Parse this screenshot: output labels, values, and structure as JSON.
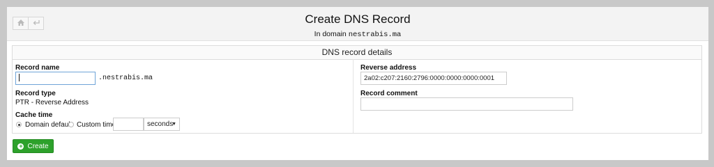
{
  "header": {
    "title": "Create DNS Record",
    "subtitle_prefix": "In domain",
    "domain": "nestrabis.ma",
    "nav": [
      {
        "icon": "home-icon"
      },
      {
        "icon": "back-arrow-icon"
      }
    ]
  },
  "panel": {
    "title": "DNS record details",
    "record_name": {
      "label": "Record name",
      "value": "",
      "suffix": ".nestrabis.ma"
    },
    "record_type": {
      "label": "Record type",
      "value": "PTR - Reverse Address"
    },
    "cache_time": {
      "label": "Cache time",
      "options": [
        "Domain default",
        "Custom time"
      ],
      "selected": "Domain default",
      "custom_value": "",
      "unit": "seconds"
    },
    "reverse_address": {
      "label": "Reverse address",
      "value": "2a02:c207:2160:2796:0000:0000:0000:0001"
    },
    "record_comment": {
      "label": "Record comment",
      "value": ""
    }
  },
  "actions": {
    "create_label": "Create",
    "create_icon": "plus-circle-icon"
  },
  "colors": {
    "accent": "#2da12b",
    "header_bg": "#f3f3f3",
    "page_bg": "#c8c8c8"
  }
}
